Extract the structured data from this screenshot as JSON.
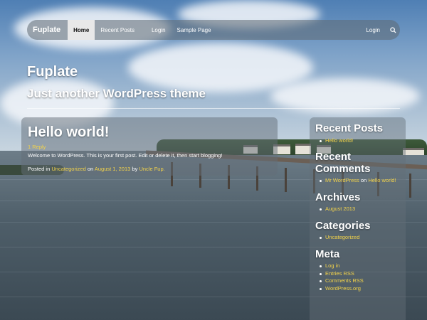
{
  "nav": {
    "brand": "Fuplate",
    "items": [
      {
        "label": "Home",
        "active": true
      },
      {
        "label": "Recent Posts",
        "active": false
      },
      {
        "label": "Login",
        "active": false
      },
      {
        "label": "Sample Page",
        "active": false
      }
    ],
    "right_login": "Login",
    "search_icon": "search-icon"
  },
  "header": {
    "title": "Fuplate",
    "description": "Just another WordPress theme"
  },
  "post": {
    "title": "Hello world!",
    "reply": "1 Reply",
    "body": "Welcome to WordPress. This is your first post. Edit or delete it, then start blogging!",
    "meta": {
      "posted_in": "Posted in",
      "category": "Uncategorized",
      "on": "on",
      "date": "August 1, 2013",
      "by": "by",
      "author": "Uncle Fup."
    }
  },
  "sidebar": {
    "recent_posts": {
      "title": "Recent Posts",
      "items": [
        "Hello world!"
      ]
    },
    "recent_comments": {
      "title": "Recent Comments",
      "items": [
        {
          "author": "Mr WordPress",
          "on": "on",
          "post": "Hello world!"
        }
      ]
    },
    "archives": {
      "title": "Archives",
      "items": [
        "August 2013"
      ]
    },
    "categories": {
      "title": "Categories",
      "items": [
        "Uncategorized"
      ]
    },
    "meta": {
      "title": "Meta",
      "items": [
        "Log in",
        "Entries RSS",
        "Comments RSS",
        "WordPress.org"
      ]
    }
  },
  "colors": {
    "link": "#f3d34a",
    "nav_active_bg": "#e8e8e8"
  }
}
